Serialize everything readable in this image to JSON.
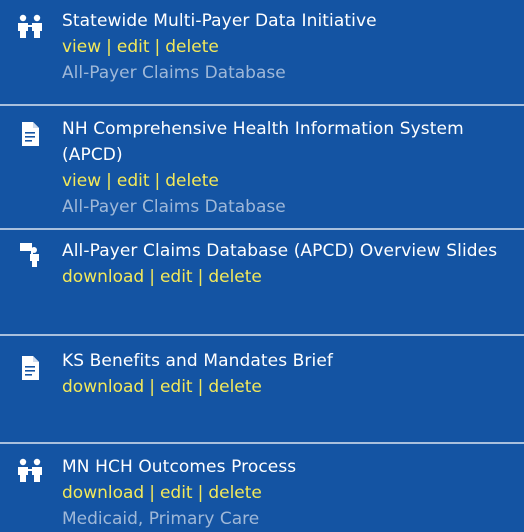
{
  "items": [
    {
      "type": "people",
      "title": "Statewide Multi-Payer Data Initiative",
      "actions": [
        "view",
        "edit",
        "delete"
      ],
      "tags": [
        "All-Payer Claims Database"
      ]
    },
    {
      "type": "document",
      "title": "NH Comprehensive Health Information System (APCD)",
      "actions": [
        "view",
        "edit",
        "delete"
      ],
      "tags": [
        "All-Payer Claims Database"
      ]
    },
    {
      "type": "presenter",
      "title": "All-Payer Claims Database (APCD) Overview Slides",
      "actions": [
        "download",
        "edit",
        "delete"
      ],
      "tags": []
    },
    {
      "type": "document",
      "title": "KS Benefits and Mandates Brief",
      "actions": [
        "download",
        "edit",
        "delete"
      ],
      "tags": []
    },
    {
      "type": "people",
      "title": "MN HCH Outcomes Process",
      "actions": [
        "download",
        "edit",
        "delete"
      ],
      "tags": [
        "Medicaid",
        "Primary Care"
      ]
    }
  ],
  "separator": "|",
  "tag_separator": ",",
  "colors": {
    "background": "#1454a3",
    "title": "#ffffff",
    "action": "#f3e95a",
    "tag": "#9fb8d8",
    "divider": "#a9c0dd"
  }
}
